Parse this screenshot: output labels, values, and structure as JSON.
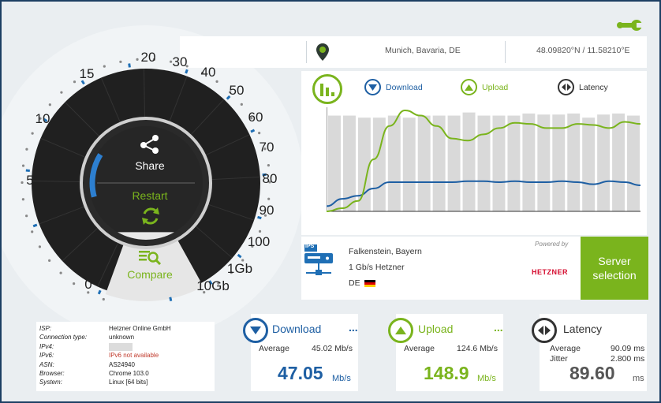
{
  "colors": {
    "accent_green": "#7ab41d",
    "download_blue": "#1e5fa3",
    "border_navy": "#1d3f63",
    "gauge_dark": "#222222",
    "gauge_tick_blue": "#1f6fb5"
  },
  "icons": {
    "settings": "wrench-icon",
    "location": "map-pin-icon",
    "chart": "bar-chart-icon",
    "share": "share-icon",
    "restart": "refresh-icon",
    "compare": "compare-icon",
    "server": "server-icon",
    "flag": "germany-flag-icon"
  },
  "location": {
    "place": "Munich, Bavaria, DE",
    "coords": "48.09820°N / 11.58210°E"
  },
  "gauge": {
    "labels": [
      "0",
      "5",
      "10",
      "15",
      "20",
      "30",
      "40",
      "50",
      "60",
      "70",
      "80",
      "90",
      "100",
      "1Gb",
      "10Gb"
    ],
    "share_label": "Share",
    "restart_label": "Restart",
    "compare_label": "Compare"
  },
  "chart_legend": {
    "download": "Download",
    "upload": "Upload",
    "latency": "Latency"
  },
  "chart_data": {
    "type": "line",
    "bars_relative": [
      0.92,
      0.92,
      0.9,
      0.9,
      0.92,
      0.9,
      0.92,
      0.92,
      0.92,
      0.95,
      0.92,
      0.92,
      0.92,
      0.94,
      0.93,
      0.93,
      0.94,
      0.9,
      0.93,
      0.94,
      0.92
    ],
    "series": [
      {
        "values": [
          0.05,
          0.12,
          0.15,
          0.22,
          0.28,
          0.28,
          0.28,
          0.28,
          0.28,
          0.29,
          0.29,
          0.28,
          0.29,
          0.28,
          0.28,
          0.29,
          0.28,
          0.26,
          0.29,
          0.28,
          0.25
        ]
      },
      {
        "values": [
          0.0,
          0.03,
          0.1,
          0.5,
          0.82,
          0.97,
          0.92,
          0.82,
          0.7,
          0.68,
          0.74,
          0.8,
          0.85,
          0.84,
          0.8,
          0.8,
          0.84,
          0.83,
          0.8,
          0.86,
          0.84
        ]
      }
    ]
  },
  "server": {
    "powered_by": "Powered by",
    "location": "Falkenstein, Bayern",
    "speed": "1 Gb/s Hetzner",
    "country": "DE",
    "provider_logo": "HETZNER",
    "ips_badge": "IPS",
    "selection_label_1": "Server",
    "selection_label_2": "selection"
  },
  "connection_info": [
    {
      "key": "ISP:",
      "value": "Hetzner Online GmbH"
    },
    {
      "key": "Connection type:",
      "value": "unknown"
    },
    {
      "key": "IPv4:",
      "value": ""
    },
    {
      "key": "IPv6:",
      "value": "IPv6 not available"
    },
    {
      "key": "ASN:",
      "value": "AS24940"
    },
    {
      "key": "Browser:",
      "value": "Chrome 103.0"
    },
    {
      "key": "System:",
      "value": "Linux [64 bits]"
    }
  ],
  "download": {
    "title": "Download",
    "more": "...",
    "average_label": "Average",
    "average_value": "45.02 Mb/s",
    "value": "47.05",
    "unit": "Mb/s"
  },
  "upload": {
    "title": "Upload",
    "more": "...",
    "average_label": "Average",
    "average_value": "124.6 Mb/s",
    "value": "148.9",
    "unit": "Mb/s"
  },
  "latency": {
    "title": "Latency",
    "average_label": "Average",
    "average_value": "90.09 ms",
    "jitter_label": "Jitter",
    "jitter_value": "2.800 ms",
    "value": "89.60",
    "unit": "ms"
  }
}
